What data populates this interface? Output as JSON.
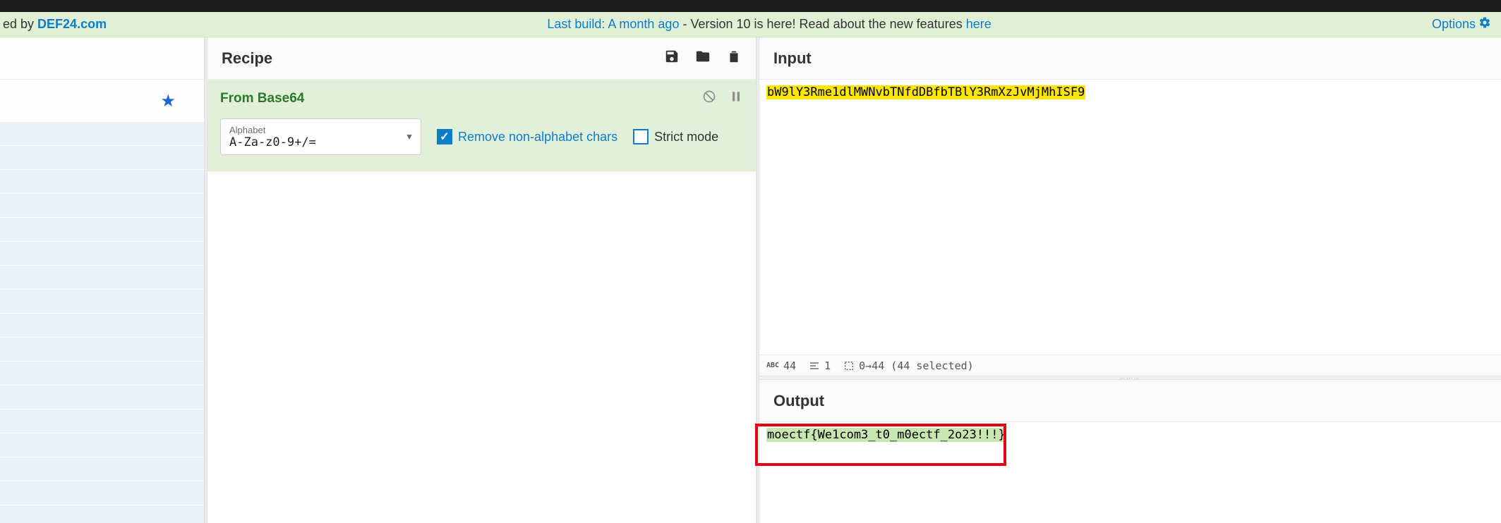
{
  "info_bar": {
    "left_prefix": "ed by ",
    "brand": "DEF24.com",
    "center_link": "Last build: A month ago",
    "center_rest": " - Version 10 is here! Read about the new features ",
    "center_here": "here",
    "options": "Options"
  },
  "sidebar": {
    "category_count": 16
  },
  "recipe": {
    "title": "Recipe",
    "op": {
      "name": "From Base64",
      "alphabet_label": "Alphabet",
      "alphabet_value": "A-Za-z0-9+/=",
      "remove_label": "Remove non-alphabet chars",
      "remove_checked": true,
      "strict_label": "Strict mode",
      "strict_checked": false
    }
  },
  "input": {
    "title": "Input",
    "text": "bW9lY3Rme1dlMWNvbTNfdDBfbTBlY3RmXzJvMjMhISF9",
    "status": {
      "chars": "44",
      "lines": "1",
      "sel": "0→44 (44 selected)"
    }
  },
  "output": {
    "title": "Output",
    "text": "moectf{We1com3_t0_m0ectf_2o23!!!}"
  }
}
